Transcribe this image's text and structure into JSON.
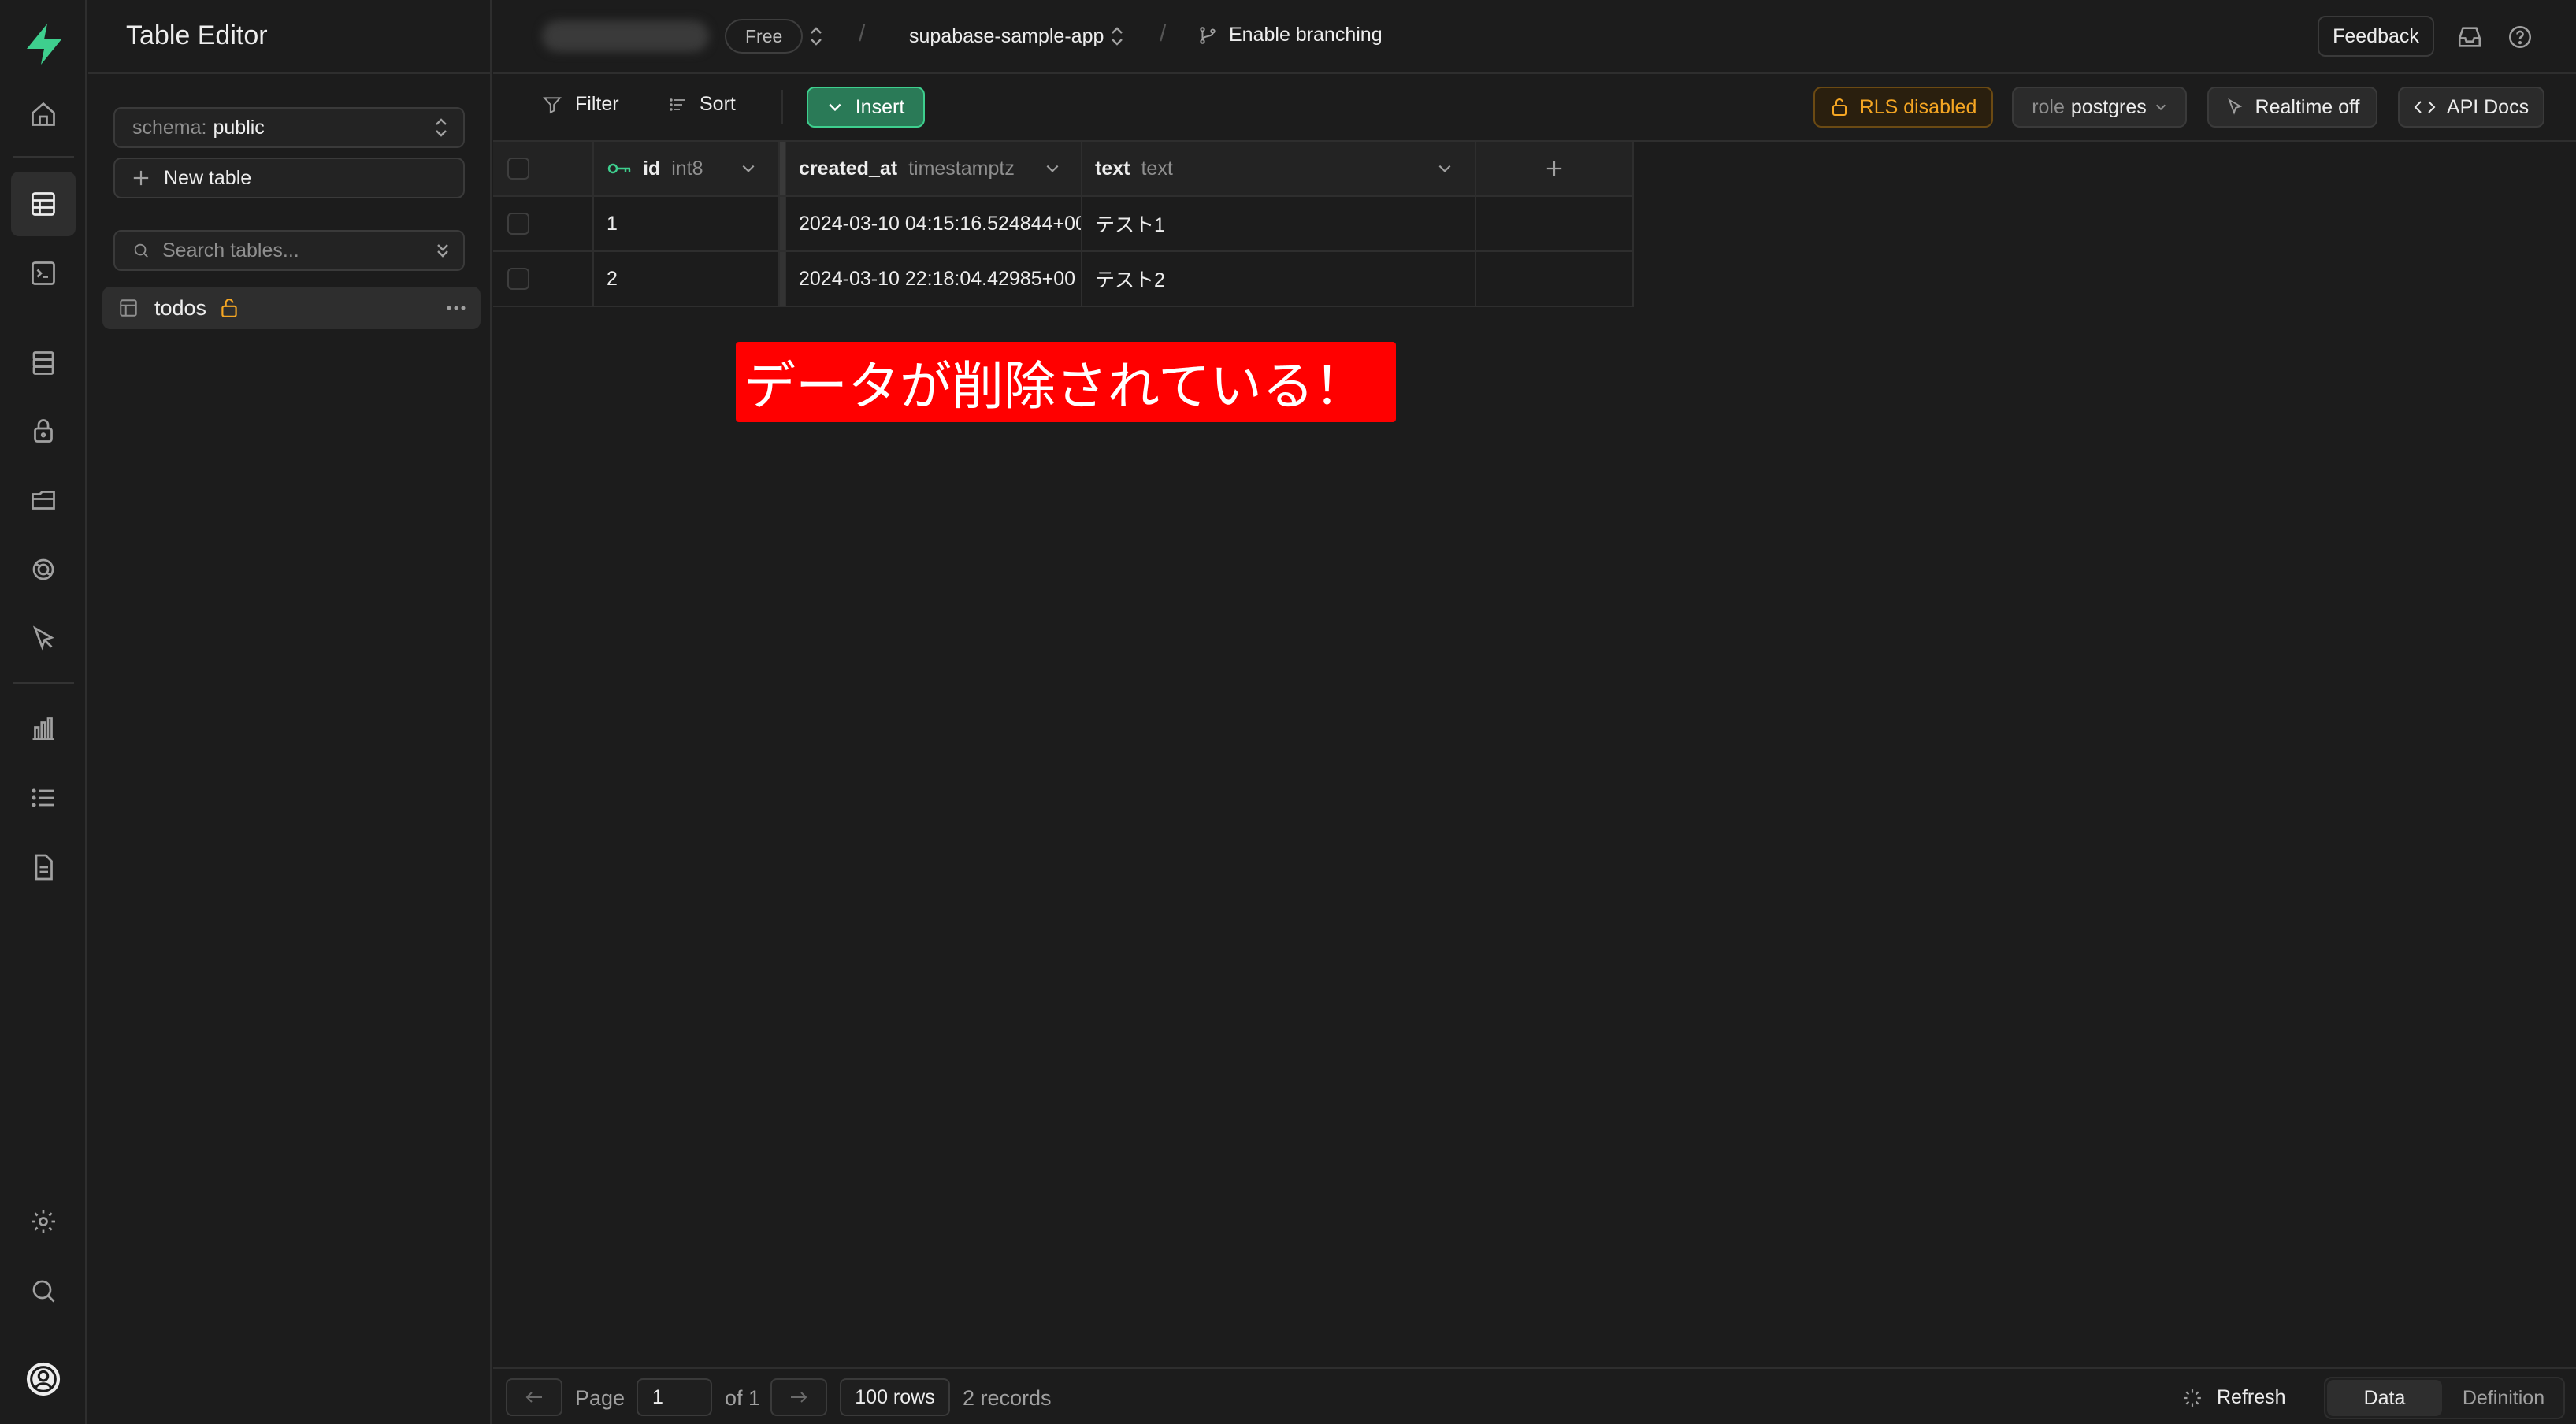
{
  "sidebar": {
    "title": "Table Editor",
    "schema_prefix": "schema:",
    "schema_value": "public",
    "new_table_label": "New table",
    "search_placeholder": "Search tables...",
    "tables": [
      {
        "name": "todos"
      }
    ]
  },
  "topbar": {
    "plan_badge": "Free",
    "project_name": "supabase-sample-app",
    "branching_label": "Enable branching",
    "feedback_label": "Feedback"
  },
  "toolbar": {
    "filter_label": "Filter",
    "sort_label": "Sort",
    "insert_label": "Insert",
    "rls_label": "RLS disabled",
    "role_prefix": "role",
    "role_value": "postgres",
    "realtime_label": "Realtime off",
    "api_docs_label": "API Docs"
  },
  "grid": {
    "columns": [
      {
        "name": "id",
        "type": "int8"
      },
      {
        "name": "created_at",
        "type": "timestamptz"
      },
      {
        "name": "text",
        "type": "text"
      }
    ],
    "rows": [
      {
        "id": "1",
        "created_at": "2024-03-10 04:15:16.524844+00",
        "text": "テスト1"
      },
      {
        "id": "2",
        "created_at": "2024-03-10 22:18:04.42985+00",
        "text": "テスト2"
      }
    ]
  },
  "annotation": {
    "text": "データが削除されている！"
  },
  "footer": {
    "page_label": "Page",
    "page_value": "1",
    "of_label": "of 1",
    "rows_label": "100 rows",
    "records_label": "2 records",
    "refresh_label": "Refresh",
    "data_tab": "Data",
    "definition_tab": "Definition"
  },
  "colors": {
    "brand": "#3ecf8e",
    "insert_bg": "#2a7a57",
    "rls_warning": "#f5a623",
    "annotation_bg": "#ff0000"
  }
}
